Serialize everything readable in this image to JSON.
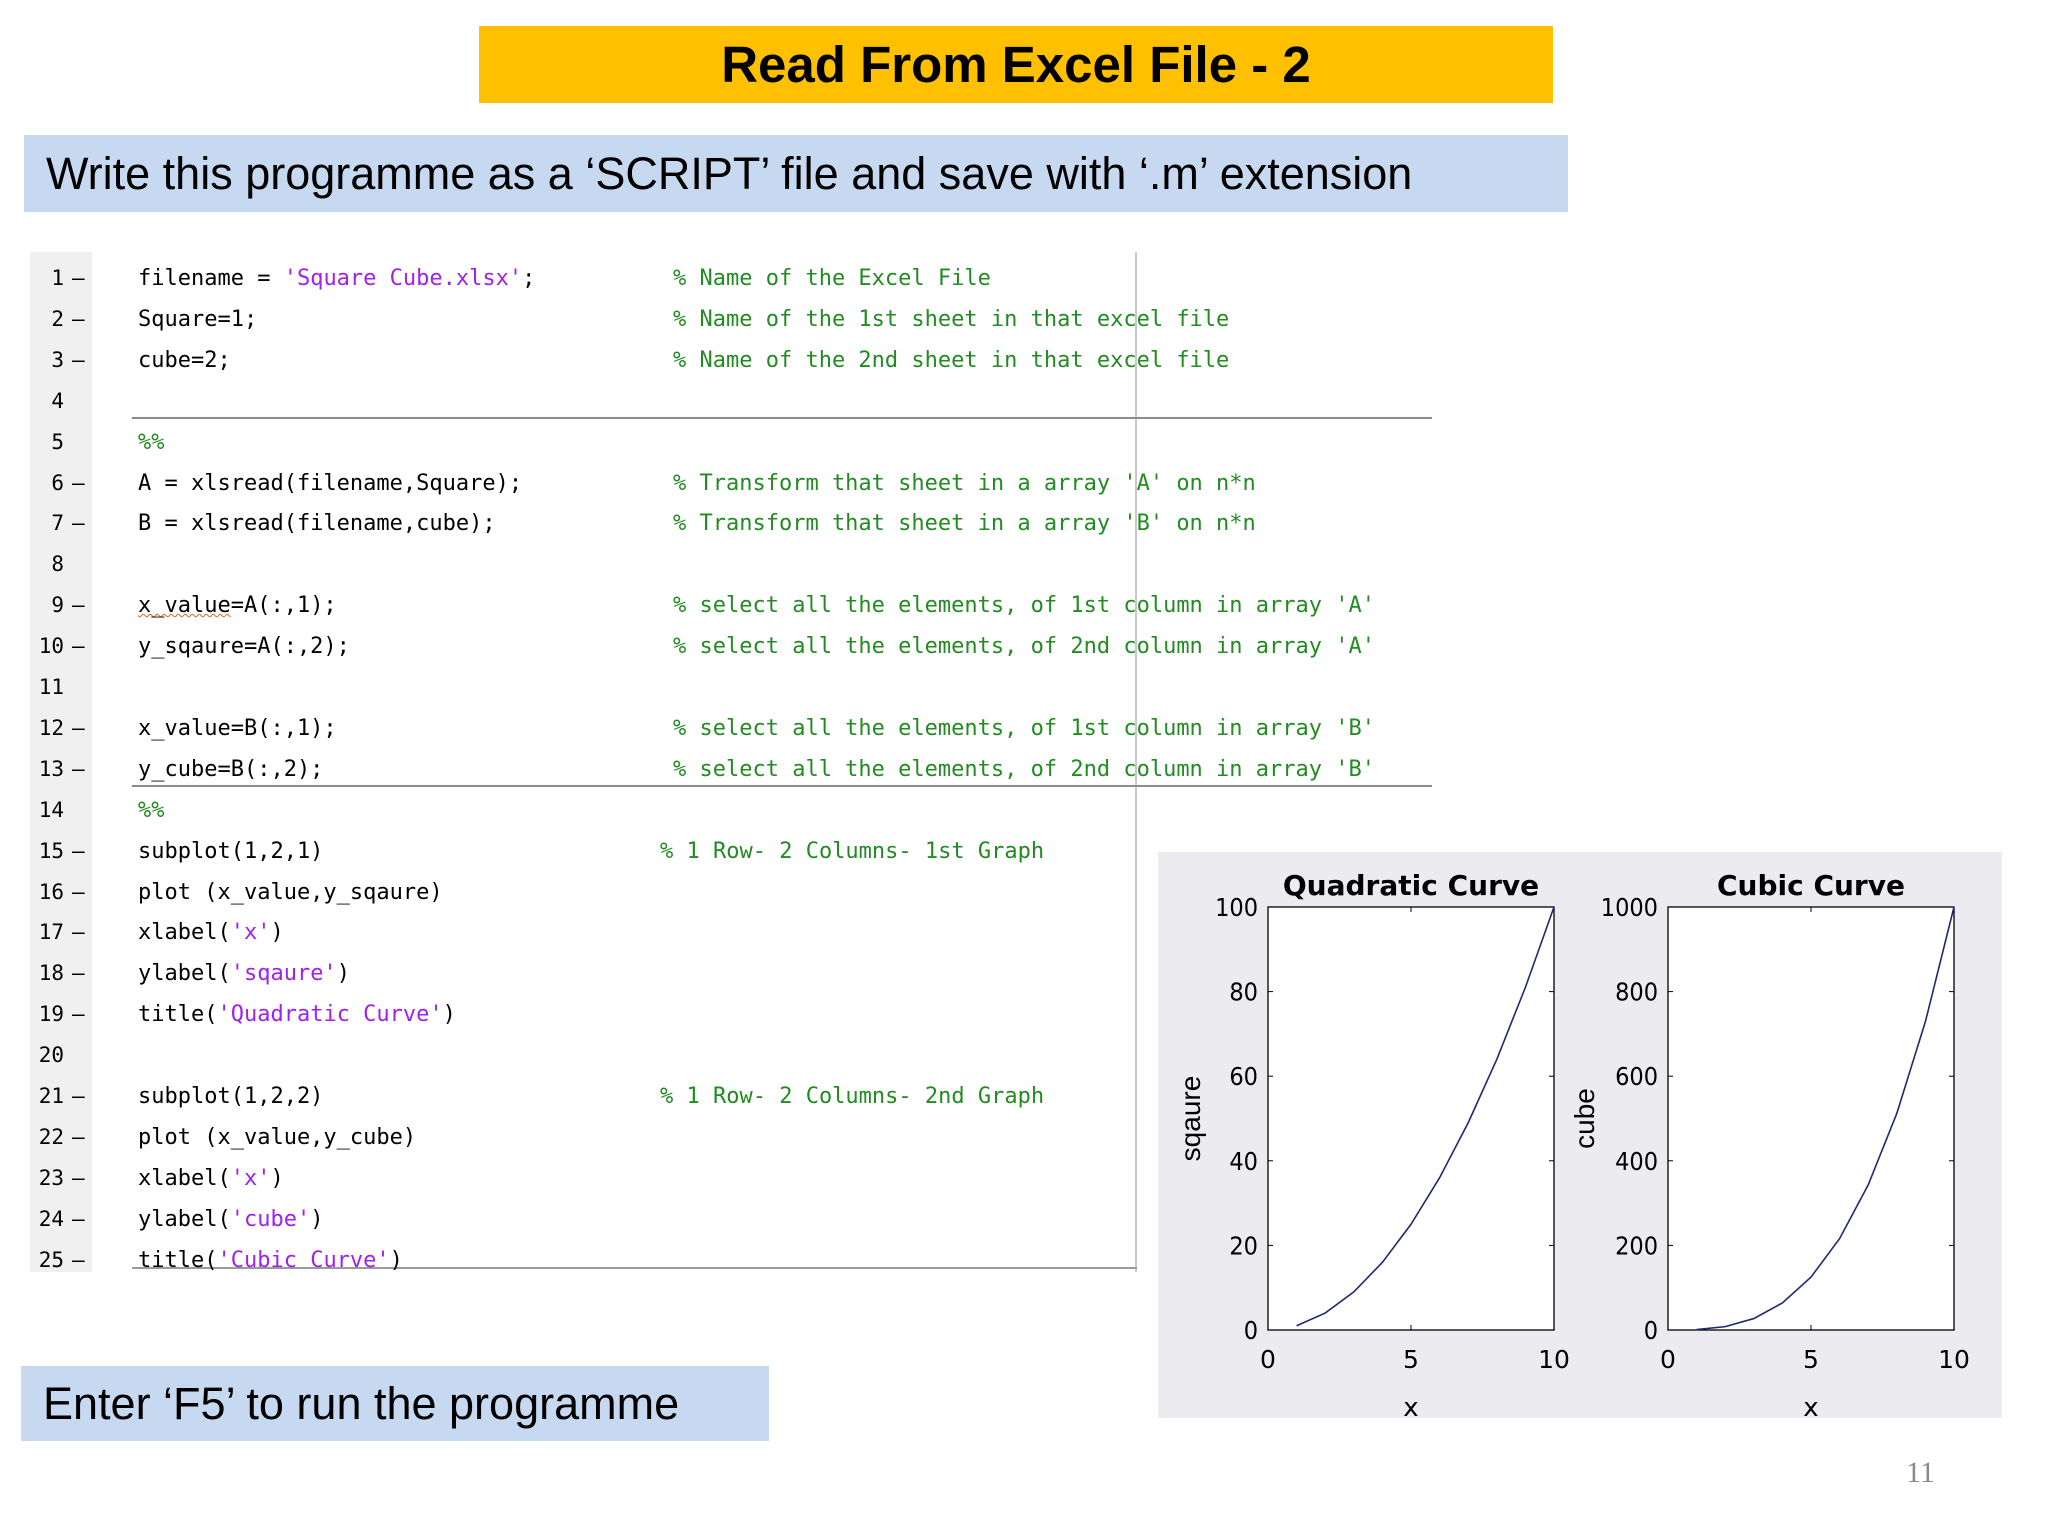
{
  "slide": {
    "title": "Read From Excel File - 2",
    "instruction": "Write this programme as a  ‘SCRIPT’ file and save with ‘.m’ extension",
    "run_note": "Enter ‘F5’ to run the programme",
    "page_number": "11"
  },
  "editor": {
    "lines": [
      {
        "num": "1",
        "marker": "–",
        "code": [
          {
            "t": "filename = "
          },
          {
            "t": "'Square Cube.xlsx'",
            "k": "str"
          },
          {
            "t": ";"
          }
        ],
        "comment": "% Name of the Excel File"
      },
      {
        "num": "2",
        "marker": "–",
        "code": [
          {
            "t": "Square=1;"
          }
        ],
        "comment": "% Name of the 1st sheet in that excel file"
      },
      {
        "num": "3",
        "marker": "–",
        "code": [
          {
            "t": "cube=2;"
          }
        ],
        "comment": "% Name of the 2nd sheet in that excel file"
      },
      {
        "num": "4",
        "marker": "",
        "code": [],
        "comment": ""
      },
      {
        "num": "5",
        "marker": "",
        "code": [
          {
            "t": "%%",
            "k": "cell"
          }
        ],
        "comment": ""
      },
      {
        "num": "6",
        "marker": "–",
        "code": [
          {
            "t": "A = xlsread(filename,Square);"
          }
        ],
        "comment": "% Transform that sheet in a array 'A' on n*n"
      },
      {
        "num": "7",
        "marker": "–",
        "code": [
          {
            "t": "B = xlsread(filename,cube);"
          }
        ],
        "comment": "% Transform that sheet in a array 'B' on n*n"
      },
      {
        "num": "8",
        "marker": "",
        "code": [],
        "comment": ""
      },
      {
        "num": "9",
        "marker": "–",
        "code": [
          {
            "t": "x_value",
            "k": "squiggle"
          },
          {
            "t": "=A(:,1);"
          }
        ],
        "comment": "% select all the elements, of 1st column in array 'A'"
      },
      {
        "num": "10",
        "marker": "–",
        "code": [
          {
            "t": "y_sqaure=A(:,2);"
          }
        ],
        "comment": "% select all the elements, of 2nd column in array 'A'"
      },
      {
        "num": "11",
        "marker": "",
        "code": [],
        "comment": ""
      },
      {
        "num": "12",
        "marker": "–",
        "code": [
          {
            "t": "x_value=B(:,1);"
          }
        ],
        "comment": "% select all the elements, of 1st column in array 'B'"
      },
      {
        "num": "13",
        "marker": "–",
        "code": [
          {
            "t": "y_cube=B(:,2);"
          }
        ],
        "comment": "% select all the elements, of 2nd column in array 'B'"
      },
      {
        "num": "14",
        "marker": "",
        "code": [
          {
            "t": "%%",
            "k": "cell"
          }
        ],
        "comment": ""
      },
      {
        "num": "15",
        "marker": "–",
        "code": [
          {
            "t": "subplot(1,2,1)"
          }
        ],
        "comment": "% 1 Row- 2 Columns- 1st Graph"
      },
      {
        "num": "16",
        "marker": "–",
        "code": [
          {
            "t": "plot (x_value,y_sqaure)"
          }
        ],
        "comment": ""
      },
      {
        "num": "17",
        "marker": "–",
        "code": [
          {
            "t": "xlabel("
          },
          {
            "t": "'x'",
            "k": "str"
          },
          {
            "t": ")"
          }
        ],
        "comment": ""
      },
      {
        "num": "18",
        "marker": "–",
        "code": [
          {
            "t": "ylabel("
          },
          {
            "t": "'sqaure'",
            "k": "str"
          },
          {
            "t": ")"
          }
        ],
        "comment": ""
      },
      {
        "num": "19",
        "marker": "–",
        "code": [
          {
            "t": "title("
          },
          {
            "t": "'Quadratic Curve'",
            "k": "str"
          },
          {
            "t": ")"
          }
        ],
        "comment": ""
      },
      {
        "num": "20",
        "marker": "",
        "code": [],
        "comment": ""
      },
      {
        "num": "21",
        "marker": "–",
        "code": [
          {
            "t": "subplot(1,2,2)"
          }
        ],
        "comment": "% 1 Row- 2 Columns- 2nd Graph"
      },
      {
        "num": "22",
        "marker": "–",
        "code": [
          {
            "t": "plot (x_value,y_cube)"
          }
        ],
        "comment": ""
      },
      {
        "num": "23",
        "marker": "–",
        "code": [
          {
            "t": "xlabel("
          },
          {
            "t": "'x'",
            "k": "str"
          },
          {
            "t": ")"
          }
        ],
        "comment": ""
      },
      {
        "num": "24",
        "marker": "–",
        "code": [
          {
            "t": "ylabel("
          },
          {
            "t": "'cube'",
            "k": "str"
          },
          {
            "t": ")"
          }
        ],
        "comment": ""
      },
      {
        "num": "25",
        "marker": "–",
        "code": [
          {
            "t": "title("
          },
          {
            "t": "'Cubic Curve'",
            "k": "str"
          },
          {
            "t": ")"
          }
        ],
        "comment": ""
      }
    ]
  },
  "colors": {
    "title_bg": "#ffc000",
    "note_bg": "#c6d9f1",
    "string": "#a020f0",
    "comment": "#228b22",
    "plot_line": "#1f2a6b"
  },
  "chart_data": [
    {
      "type": "line",
      "title": "Quadratic Curve",
      "xlabel": "x",
      "ylabel": "sqaure",
      "xlim": [
        0,
        10
      ],
      "ylim": [
        0,
        100
      ],
      "xticks": [
        "0",
        "5",
        "10"
      ],
      "yticks": [
        "0",
        "20",
        "40",
        "60",
        "80",
        "100"
      ],
      "series": [
        {
          "x": [
            1,
            2,
            3,
            4,
            5,
            6,
            7,
            8,
            9,
            10
          ],
          "values": [
            1,
            4,
            9,
            16,
            25,
            36,
            49,
            64,
            81,
            100
          ]
        }
      ]
    },
    {
      "type": "line",
      "title": "Cubic Curve",
      "xlabel": "x",
      "ylabel": "cube",
      "xlim": [
        0,
        10
      ],
      "ylim": [
        0,
        1000
      ],
      "xticks": [
        "0",
        "5",
        "10"
      ],
      "yticks": [
        "0",
        "200",
        "400",
        "600",
        "800",
        "1000"
      ],
      "series": [
        {
          "x": [
            1,
            2,
            3,
            4,
            5,
            6,
            7,
            8,
            9,
            10
          ],
          "values": [
            1,
            8,
            27,
            64,
            125,
            216,
            343,
            512,
            729,
            1000
          ]
        }
      ]
    }
  ]
}
